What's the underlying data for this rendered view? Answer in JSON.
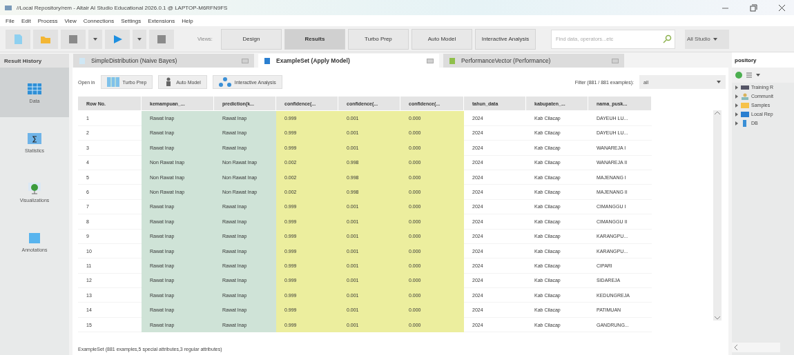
{
  "window": {
    "title": "//Local Repository/rem - Altair AI Studio Educational 2026.0.1 @ LAPTOP-M6RFN9FS"
  },
  "menu": [
    "File",
    "Edit",
    "Process",
    "View",
    "Connections",
    "Settings",
    "Extensions",
    "Help"
  ],
  "toolbar": {
    "views_label": "Views:",
    "views": [
      {
        "label": "Design",
        "selected": false
      },
      {
        "label": "Results",
        "selected": true
      },
      {
        "label": "Turbo Prep",
        "selected": false
      },
      {
        "label": "Auto Model",
        "selected": false
      },
      {
        "label": "Interactive Analysis",
        "selected": false
      }
    ],
    "search": {
      "placeholder": "Find data, operators...etc"
    },
    "scope": "All Studio"
  },
  "result_history": {
    "title": "Result History"
  },
  "tabs": [
    {
      "label": "SimpleDistribution (Naive Bayes)",
      "selected": false
    },
    {
      "label": "ExampleSet (Apply Model)",
      "selected": true
    },
    {
      "label": "PerformanceVector (Performance)",
      "selected": false
    }
  ],
  "sidebar": [
    {
      "label": "Data",
      "selected": true
    },
    {
      "label": "Statistics",
      "selected": false
    },
    {
      "label": "Visualizations",
      "selected": false
    },
    {
      "label": "Annotations",
      "selected": false
    }
  ],
  "open_in": {
    "label": "Open in",
    "buttons": [
      "Turbo Prep",
      "Auto Model",
      "Interactive Analysis"
    ]
  },
  "filter": {
    "label": "Filter (881 / 881 examples):",
    "value": "all"
  },
  "table": {
    "columns": [
      {
        "label": "Row No.",
        "kind": "id"
      },
      {
        "label": "kemampuan_...",
        "kind": "label"
      },
      {
        "label": "prediction(k...",
        "kind": "label"
      },
      {
        "label": "confidence(...",
        "kind": "confidence"
      },
      {
        "label": "confidence(...",
        "kind": "confidence"
      },
      {
        "label": "confidence(...",
        "kind": "confidence"
      },
      {
        "label": "tahun_data",
        "kind": "regular"
      },
      {
        "label": "kabupaten_...",
        "kind": "regular"
      },
      {
        "label": "nama_pusk...",
        "kind": "regular"
      }
    ],
    "rows": [
      [
        "1",
        "Rawat Inap",
        "Rawat Inap",
        "0.999",
        "0.001",
        "0.000",
        "2024",
        "Kab Cilacap",
        "DAYEUH LU..."
      ],
      [
        "2",
        "Rawat Inap",
        "Rawat Inap",
        "0.999",
        "0.001",
        "0.000",
        "2024",
        "Kab Cilacap",
        "DAYEUH LU..."
      ],
      [
        "3",
        "Rawat Inap",
        "Rawat Inap",
        "0.999",
        "0.001",
        "0.000",
        "2024",
        "Kab Cilacap",
        "WANAREJA I"
      ],
      [
        "4",
        "Non Rawat Inap",
        "Non Rawat Inap",
        "0.002",
        "0.998",
        "0.000",
        "2024",
        "Kab Cilacap",
        "WANAREJA II"
      ],
      [
        "5",
        "Non Rawat Inap",
        "Non Rawat Inap",
        "0.002",
        "0.998",
        "0.000",
        "2024",
        "Kab Cilacap",
        "MAJENANG I"
      ],
      [
        "6",
        "Non Rawat Inap",
        "Non Rawat Inap",
        "0.002",
        "0.998",
        "0.000",
        "2024",
        "Kab Cilacap",
        "MAJENANG II"
      ],
      [
        "7",
        "Rawat Inap",
        "Rawat Inap",
        "0.999",
        "0.001",
        "0.000",
        "2024",
        "Kab Cilacap",
        "CIMANGGU I"
      ],
      [
        "8",
        "Rawat Inap",
        "Rawat Inap",
        "0.999",
        "0.001",
        "0.000",
        "2024",
        "Kab Cilacap",
        "CIMANGGU II"
      ],
      [
        "9",
        "Rawat Inap",
        "Rawat Inap",
        "0.999",
        "0.001",
        "0.000",
        "2024",
        "Kab Cilacap",
        "KARANGPU..."
      ],
      [
        "10",
        "Rawat Inap",
        "Rawat Inap",
        "0.999",
        "0.001",
        "0.000",
        "2024",
        "Kab Cilacap",
        "KARANGPU..."
      ],
      [
        "11",
        "Rawat Inap",
        "Rawat Inap",
        "0.999",
        "0.001",
        "0.000",
        "2024",
        "Kab Cilacap",
        "CIPARI"
      ],
      [
        "12",
        "Rawat Inap",
        "Rawat Inap",
        "0.999",
        "0.001",
        "0.000",
        "2024",
        "Kab Cilacap",
        "SIDAREJA"
      ],
      [
        "13",
        "Rawat Inap",
        "Rawat Inap",
        "0.999",
        "0.001",
        "0.000",
        "2024",
        "Kab Cilacap",
        "KEDUNGREJA"
      ],
      [
        "14",
        "Rawat Inap",
        "Rawat Inap",
        "0.999",
        "0.001",
        "0.000",
        "2024",
        "Kab Cilacap",
        "PATIMUAN"
      ],
      [
        "15",
        "Rawat Inap",
        "Rawat Inap",
        "0.999",
        "0.001",
        "0.000",
        "2024",
        "Kab Cilacap",
        "GANDRUNG..."
      ]
    ]
  },
  "footer": "ExampleSet (881 examples,5 special attributes,3 regular attributes)",
  "repository": {
    "title": "pository",
    "items": [
      "Training R",
      "Communit",
      "Samples",
      "Local Rep",
      "DB"
    ]
  }
}
